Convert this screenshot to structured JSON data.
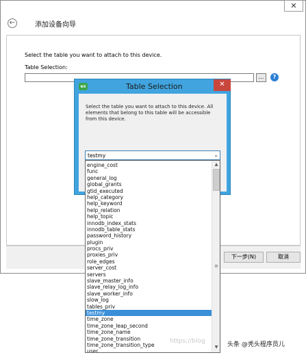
{
  "wizard": {
    "title": "添加设备向导",
    "close_glyph": "✕",
    "back_glyph": "←",
    "prompt": "Select the table you want to attach to this device.",
    "table_selection_label": "Table Selection:",
    "table_selection_value": "",
    "browse_label": "...",
    "help_glyph": "?",
    "next_label": "下一步(N)",
    "cancel_label": "取消"
  },
  "dialog": {
    "title": "Table Selection",
    "icon_text": "ex",
    "close_glyph": "✕",
    "message": "Select the table you want to attach to this device. All elements that belong to this table will be accessible from this device.",
    "selected_value": "testmy",
    "arrow_glyph": "⌄",
    "options": [
      "engine_cost",
      "func",
      "general_log",
      "global_grants",
      "gtid_executed",
      "help_category",
      "help_keyword",
      "help_relation",
      "help_topic",
      "innodb_index_stats",
      "innodb_table_stats",
      "password_history",
      "plugin",
      "procs_priv",
      "proxies_priv",
      "role_edges",
      "server_cost",
      "servers",
      "slave_master_info",
      "slave_relay_log_info",
      "slave_worker_info",
      "slow_log",
      "tables_priv",
      "testmy",
      "time_zone",
      "time_zone_leap_second",
      "time_zone_name",
      "time_zone_transition",
      "time_zone_transition_type",
      "user"
    ],
    "selected_index": 23,
    "scroll_up_glyph": "▲",
    "scroll_down_glyph": "▼",
    "scroll_grip_glyph": "≡"
  },
  "watermark": {
    "url_text": "https://blog",
    "author_text": "头条 @秃头程序员儿"
  }
}
